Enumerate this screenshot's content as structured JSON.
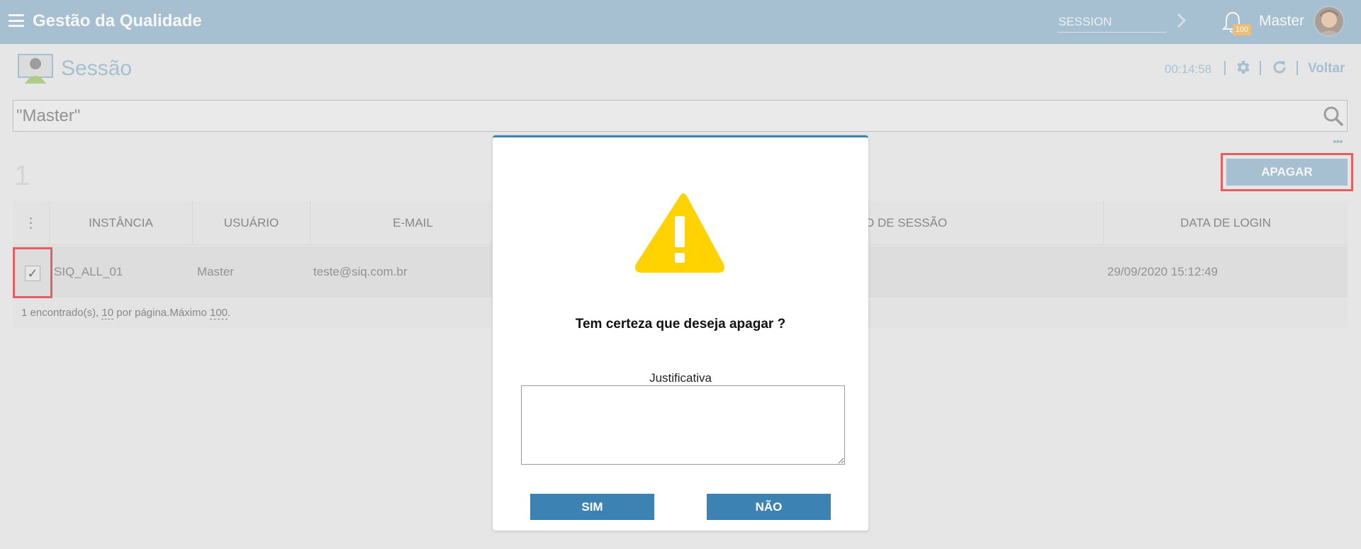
{
  "topbar": {
    "app_title": "Gestão da Qualidade",
    "session_placeholder": "SESSION",
    "notification_count": "100",
    "user_name": "Master"
  },
  "header": {
    "title": "Sessão",
    "timer": "00:14:58",
    "back_label": "Voltar"
  },
  "search": {
    "value": "\"Master\""
  },
  "result_count": "1",
  "actions": {
    "delete_label": "APAGAR"
  },
  "table": {
    "columns": [
      "INSTÂNCIA",
      "USUÁRIO",
      "E-MAIL",
      "O DE SESSÃO",
      "DATA DE LOGIN"
    ],
    "rows": [
      {
        "checked": "✓",
        "instancia": "SIQ_ALL_01",
        "usuario": "Master",
        "email": "teste@siq.com.br",
        "data_login": "29/09/2020 15:12:49"
      }
    ],
    "pager": {
      "found": "1 encontrado(s), ",
      "per_page": "10",
      "per_page_suffix": " por página.Máximo ",
      "max": "100",
      "end": "."
    }
  },
  "modal": {
    "question": "Tem certeza que deseja apagar ?",
    "justification_label": "Justificativa",
    "yes_label": "SIM",
    "no_label": "NÃO"
  },
  "colors": {
    "topbar": "#84adc6",
    "modal_button": "#3c83b4",
    "highlight": "#e4171c",
    "warning": "#ffd200"
  }
}
